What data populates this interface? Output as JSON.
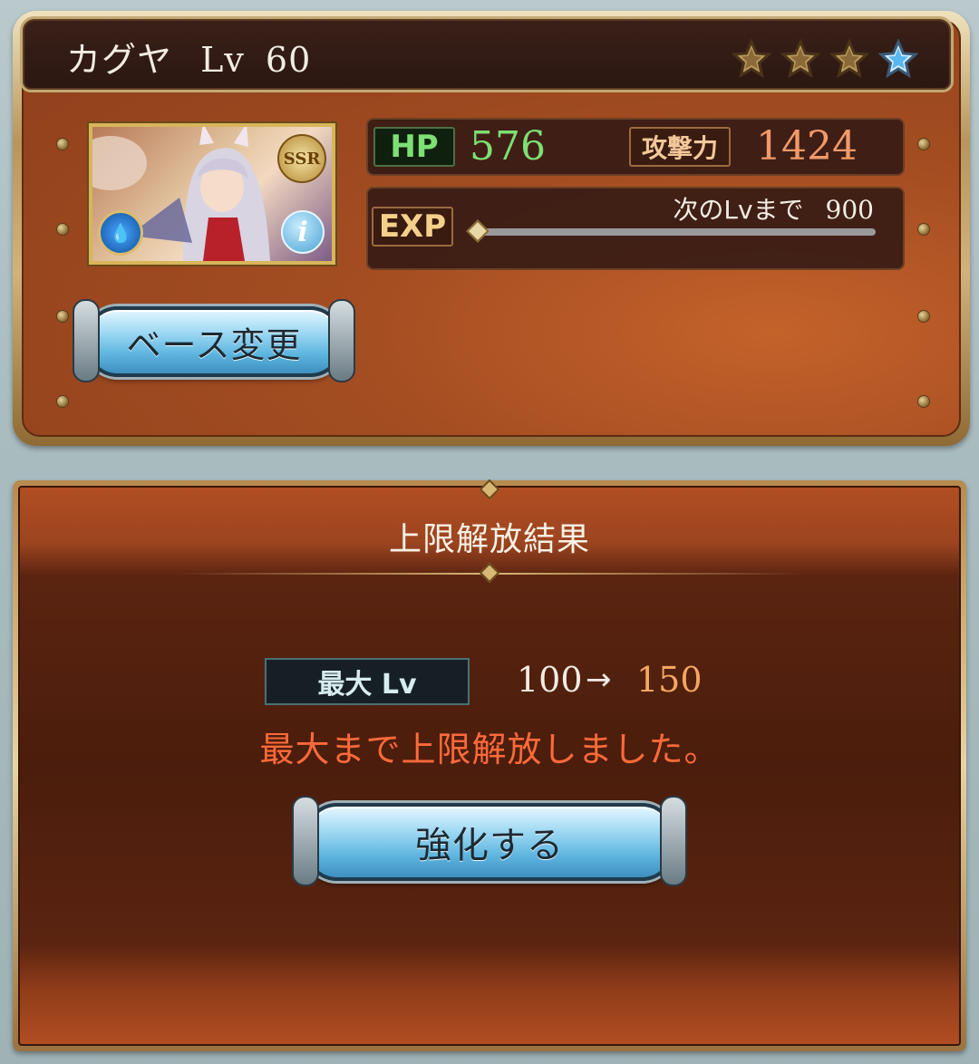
{
  "header": {
    "name": "カグヤ",
    "level_label": "Lv",
    "level": "60",
    "stars_filled": 4,
    "stars_total": 4
  },
  "portrait": {
    "rarity": "SSR",
    "element_icon": "water-icon",
    "info_icon": "info-icon"
  },
  "stats": {
    "hp_label": "HP",
    "hp_value": "576",
    "atk_label": "攻撃力",
    "atk_value": "1424",
    "exp_label": "EXP",
    "next_label": "次のLvまで",
    "next_value": "900",
    "exp_progress": 0.0
  },
  "actions": {
    "base_change": "ベース変更",
    "enhance": "強化する"
  },
  "result": {
    "title": "上限解放結果",
    "maxlv_label": "最大 Lv",
    "lv_from": "100",
    "arrow": "→",
    "lv_to": "150",
    "notice": "最大まで上限解放しました。"
  },
  "colors": {
    "hp_green": "#7ddf74",
    "atk_orange": "#f29a6a",
    "notice_red": "#ff6a3a",
    "lv_to_gold": "#f2a860"
  }
}
